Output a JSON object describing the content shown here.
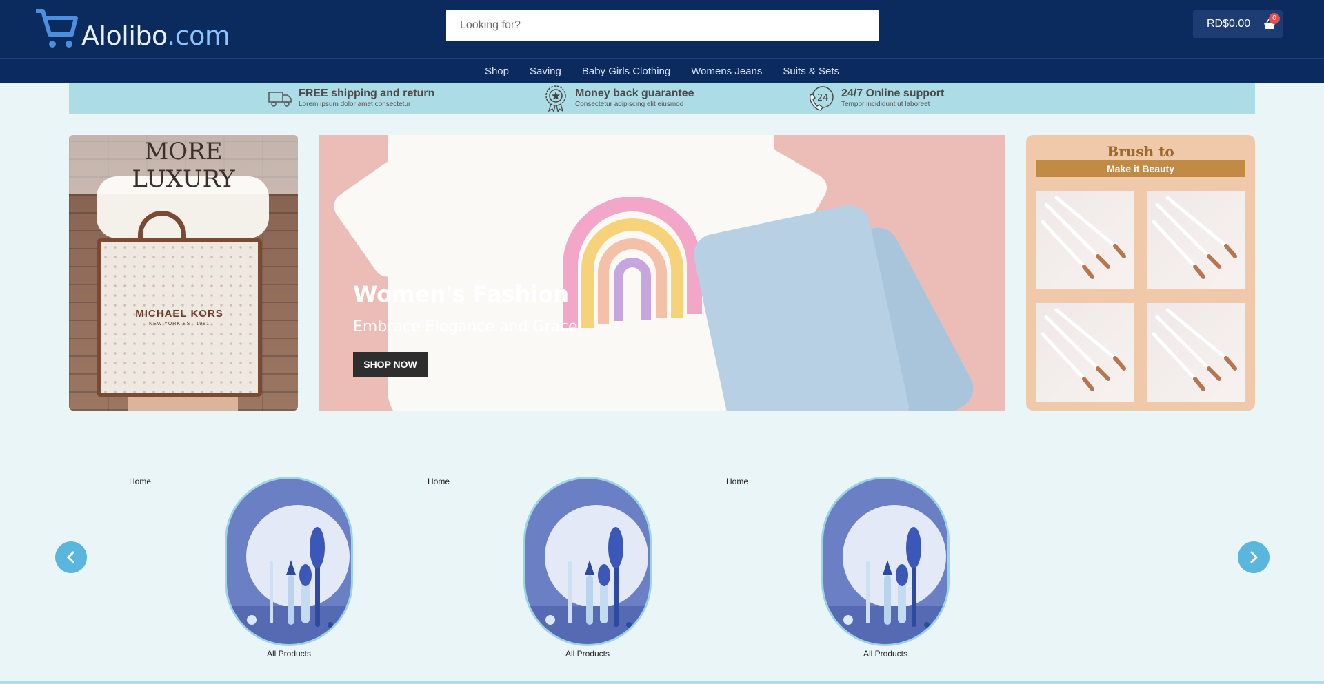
{
  "header": {
    "logo_text": "Alolibo",
    "logo_suffix": ".com",
    "search_placeholder": "Looking for?",
    "cart_total": "RD$0.00",
    "cart_count": "0"
  },
  "nav": [
    "Shop",
    "Saving",
    "Baby Girls Clothing",
    "Womens Jeans",
    "Suits & Sets"
  ],
  "features": [
    {
      "title": "FREE shipping and return",
      "subtitle": "Lorem ipsum dolor amet consectetur",
      "icon": "truck-icon"
    },
    {
      "title": "Money back guarantee",
      "subtitle": "Consectetur adipiscing elit eiusmod",
      "icon": "badge-icon"
    },
    {
      "title": "24/7 Online support",
      "subtitle": "Tempor incididunt ut laboreet",
      "icon": "phone-24-icon"
    }
  ],
  "banner_left": {
    "line1": "MORE",
    "line2": "LUXURY",
    "bag_brand": "MICHAEL KORS",
    "bag_sub": "NEW YORK EST 1981"
  },
  "banner_main": {
    "title": "Women's Fashion",
    "subtitle": "Embrace Elegance and Grace!",
    "button": "SHOP NOW"
  },
  "banner_right": {
    "title": "Brush to",
    "bar": "Make it Beauty"
  },
  "carousel": {
    "items": [
      {
        "home": "Home",
        "label": "All Products"
      },
      {
        "home": "Home",
        "label": "All Products"
      },
      {
        "home": "Home",
        "label": "All Products"
      }
    ]
  },
  "colors": {
    "header_bg": "#0b2a5e",
    "feature_strip": "#acdde6",
    "accent": "#5bb6de",
    "badge": "#e05050"
  }
}
